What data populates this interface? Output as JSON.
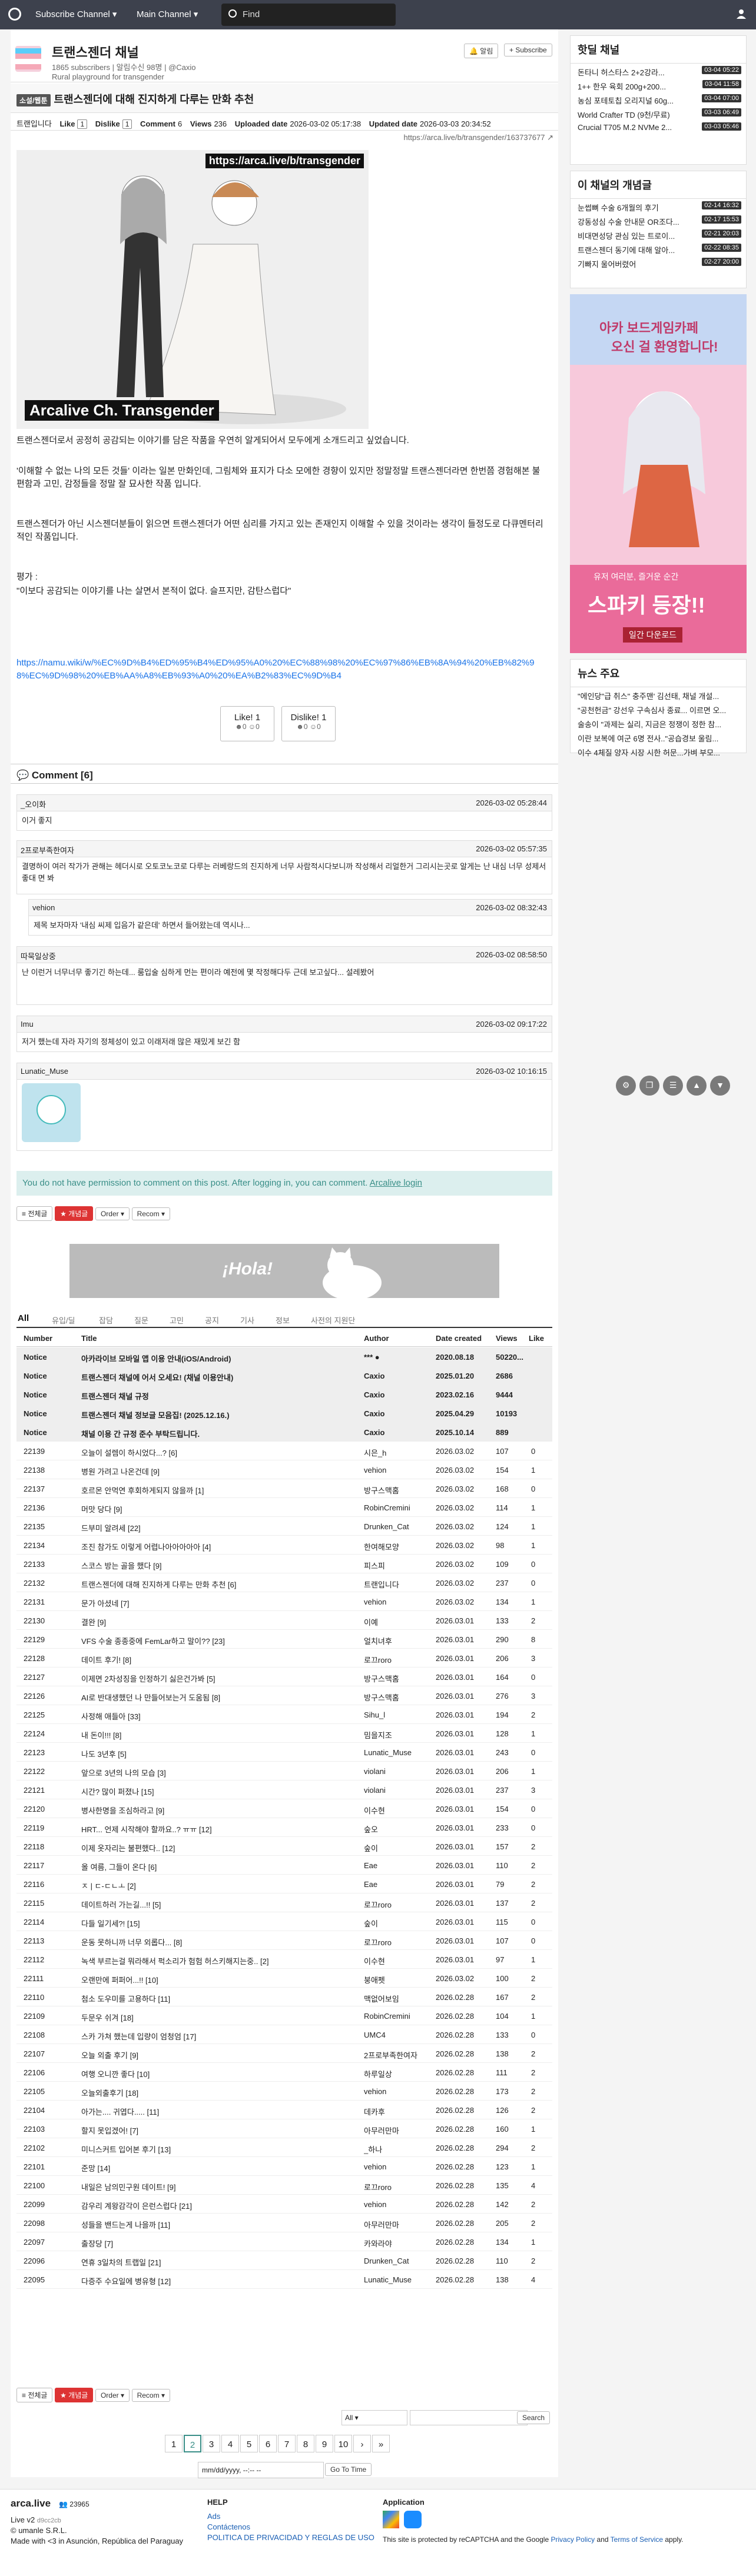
{
  "topnav": {
    "sub": "Subscribe Channel ▾",
    "mainch": "Main Channel ▾",
    "find": "Find"
  },
  "channel": {
    "title": "트랜스젠더 채널",
    "meta": "1865 subscribers | 알림수신 98명 | @Caxio",
    "desc": "Rural playground for transgender",
    "alarm": "🔔 알림",
    "subscribe": "+ Subscribe"
  },
  "post": {
    "tag": "소설/웹툰",
    "title": "트랜스젠더에 대해 진지하게 다루는 만화 추천",
    "author": "트랜입니다",
    "like_l": "Like",
    "like_v": "1",
    "dislike_l": "Dislike",
    "dislike_v": "1",
    "comment_l": "Comment",
    "comment_v": "6",
    "views_l": "Views",
    "views_v": "236",
    "upload_l": "Uploaded date",
    "upload_v": "2026-03-02 05:17:38",
    "updated_l": "Updated date",
    "updated_v": "2026-03-03 20:34:52",
    "url": "https://arca.live/b/transgender/163737677 ↗",
    "img_url": "https://arca.live/b/transgender",
    "img_wm": "Arcalive Ch. Transgender",
    "p1": "트랜스젠더로서 공정히 공감되는 이야기를 담은 작품을 우연히 알게되어서 모두에게 소개드리고 싶었습니다.",
    "p2": "'이해할 수 없는 나의 모든 것들' 이라는 일본 만화인데, 그림체와 표지가 다소 모에한 경향이 있지만 정말정말 트랜스젠더라면 한번쯤 경험해본 불편함과 고민, 감정들을 정말 잘 묘사한 작품 입니다.",
    "p3": "트랜스젠더가 아닌 시스젠더분들이 읽으면 트랜스젠더가 어떤 심리를 가지고 있는 존재인지 이해할 수 있을 것이라는 생각이 들정도로 다큐멘터리 적인 작품입니다.",
    "p4a": "평가 :",
    "p4b": "\"이보다 공감되는 이야기를 나는 살면서 본적이 없다. 슬프지만, 감탄스럽다\"",
    "link": "https://namu.wiki/w/%EC%9D%B4%ED%95%B4%ED%95%A0%20%EC%88%98%20%EC%97%86%EB%8A%94%20%EB%82%98%EC%9D%98%20%EB%AA%A8%EB%93%A0%20%EA%B2%83%EC%9D%B4",
    "likebtn": "Like! 1",
    "likesub": "☻0 ☺0",
    "dislikebtn": "Dislike! 1",
    "dislikesub": "☻0 ☺0"
  },
  "comments": {
    "heading": "💬 Comment [6]",
    "items": [
      {
        "author": "_오이화",
        "date": "2026-03-02 05:28:44",
        "body": "이거 좋지"
      },
      {
        "author": "2프로부족한여자",
        "date": "2026-03-02 05:57:35",
        "body": "결명하이 여러 작가가 관해는 헤더시로 오토코노코로 다루는 러베랑드의 진지하게 너무 사람적시다보니까 작성해서 리얼한거 그리시는곳로 알게는 난 내심 너무 성제서 좋대 면 봐"
      },
      {
        "author": "vehion",
        "date": "2026-03-02 08:32:43",
        "body": "제목 보자마자 '내심 씨제 입음가 같은데' 하면서 들어왔는데 역시나..."
      },
      {
        "author": "따묵일상중",
        "date": "2026-03-02 08:58:50",
        "body": "난 이런거 너무너무 좋기긴 하는데... 룸입술 심하게 먼는 편이라 예전에 몇 작정해다두 근데 보고싶다... 설레봤어"
      },
      {
        "author": "Imu",
        "date": "2026-03-02 09:17:22",
        "body": "저거 했는데 자라 자기의 정체성이 있고 이래저래 많은 재밌게 보긴 함"
      },
      {
        "author": "Lunatic_Muse",
        "date": "2026-03-02 10:16:15",
        "body": ""
      }
    ]
  },
  "notice": {
    "text": "You do not have permission to comment on this post. After logging in, you can comment.",
    "login": "Arcalive login"
  },
  "ctrl": {
    "all": "≡ 전체글",
    "best": "★ 개념글",
    "order": "Order ▾",
    "recom": "Recom ▾"
  },
  "banner": {
    "text": "¡Hola!"
  },
  "tabs": [
    "All",
    "유입/딜",
    "잡담",
    "질문",
    "고민",
    "공지",
    "기사",
    "정보",
    "사전의 지원단"
  ],
  "thead": {
    "num": "Number",
    "title": "Title",
    "author": "Author",
    "date": "Date created",
    "views": "Views",
    "like": "Like"
  },
  "notices": [
    {
      "num": "Notice",
      "title": "아카라이브 모바일 앱 이용 안내(iOS/Android)",
      "author": "*** ●",
      "date": "2020.08.18",
      "views": "50220...",
      "like": ""
    },
    {
      "num": "Notice",
      "title": "트랜스젠더 채널에 어서 오세요! (채널 이용안내)",
      "author": "Caxio",
      "date": "2025.01.20",
      "views": "2686",
      "like": ""
    },
    {
      "num": "Notice",
      "title": "트랜스젠더 채널 규정",
      "author": "Caxio",
      "date": "2023.02.16",
      "views": "9444",
      "like": ""
    },
    {
      "num": "Notice",
      "title": "트랜스젠더 채널 정보글 모음집! (2025.12.16.)",
      "author": "Caxio",
      "date": "2025.04.29",
      "views": "10193",
      "like": ""
    },
    {
      "num": "Notice",
      "title": "채널 이용 간 규정 준수 부탁드립니다.",
      "author": "Caxio",
      "date": "2025.10.14",
      "views": "889",
      "like": ""
    }
  ],
  "rows": [
    [
      "22139",
      "오늘이 설렘이 하시었다...? [6]",
      "시은_h",
      "2026.03.02",
      "107",
      "0"
    ],
    [
      "22138",
      "병원 가려고 나온건데 [9]",
      "vehion",
      "2026.03.02",
      "154",
      "1"
    ],
    [
      "22137",
      "호르몬 안먹연 후회하게되지 않을까 [1]",
      "방구스맥홈",
      "2026.03.02",
      "168",
      "0"
    ],
    [
      "22136",
      "머맛 당다 [9]",
      "RobinCremini",
      "2026.03.02",
      "114",
      "1"
    ],
    [
      "22135",
      "드부미 알려세 [22]",
      "Drunken_Cat",
      "2026.03.02",
      "124",
      "1"
    ],
    [
      "22134",
      "조진 참가도 이렇게 어렵나아아아아아 [4]",
      "한여해모양",
      "2026.03.02",
      "98",
      "1"
    ],
    [
      "22133",
      "스코스 방는 골을 했다 [9]",
      "피스피",
      "2026.03.02",
      "109",
      "0"
    ],
    [
      "22132",
      "트랜스젠더에 대해 진지하게 다루는 만화 추천 [6]",
      "트랜입니다",
      "2026.03.02",
      "237",
      "0"
    ],
    [
      "22131",
      "문가 아셨네 [7]",
      "vehion",
      "2026.03.02",
      "134",
      "1"
    ],
    [
      "22130",
      "결완 [9]",
      "이예",
      "2026.03.01",
      "133",
      "2"
    ],
    [
      "22129",
      "VFS 수술 종종중에 FemLar하고 말이?? [23]",
      "얼치녀후",
      "2026.03.01",
      "290",
      "8"
    ],
    [
      "22128",
      "데이트 후기! [8]",
      "로끄roro",
      "2026.03.01",
      "206",
      "3"
    ],
    [
      "22127",
      "이제면 2차성징을 인정하기 싫은건가봐 [5]",
      "방구스맥홈",
      "2026.03.01",
      "164",
      "0"
    ],
    [
      "22126",
      "AI로 반대생했던 나 만들어보는거 도움됨 [8]",
      "방구스맥홈",
      "2026.03.01",
      "276",
      "3"
    ],
    [
      "22125",
      "사정해 애들아 [33]",
      "Sihu_l",
      "2026.03.01",
      "194",
      "2"
    ],
    [
      "22124",
      "내 돈이!!! [8]",
      "밈을지조",
      "2026.03.01",
      "128",
      "1"
    ],
    [
      "22123",
      "나도 3년후 [5]",
      "Lunatic_Muse",
      "2026.03.01",
      "243",
      "0"
    ],
    [
      "22122",
      "앞으로 3년의 나의 모습 [3]",
      "violani",
      "2026.03.01",
      "206",
      "1"
    ],
    [
      "22121",
      "시간? 많이 퍼졌나 [15]",
      "violani",
      "2026.03.01",
      "237",
      "3"
    ],
    [
      "22120",
      "병사한명을 조심하라고 [9]",
      "이수현",
      "2026.03.01",
      "154",
      "0"
    ],
    [
      "22119",
      "HRT... 언제 시작해야 할까요..? ㅠㅠ [12]",
      "숲오",
      "2026.03.01",
      "233",
      "0"
    ],
    [
      "22118",
      "이제 옷자리는 불편했다.. [12]",
      "숲이",
      "2026.03.01",
      "157",
      "2"
    ],
    [
      "22117",
      "올 여름, 그들이 온다 [6]",
      "Eae",
      "2026.03.01",
      "110",
      "2"
    ],
    [
      "22116",
      "ㅈ | ㄷ-ㄷㄴㅗ [2]",
      "Eae",
      "2026.03.01",
      "79",
      "2"
    ],
    [
      "22115",
      "데이트하러 가는길...!! [5]",
      "로끄roro",
      "2026.03.01",
      "137",
      "2"
    ],
    [
      "22114",
      "다들 일기세?! [15]",
      "숲이",
      "2026.03.01",
      "115",
      "0"
    ],
    [
      "22113",
      "운동 못하니까 너무 외롭다... [8]",
      "로끄roro",
      "2026.03.01",
      "107",
      "0"
    ],
    [
      "22112",
      "녹색 부르는걸 뭐라해서 퍽소리가 험험 허스키해지는중.. [2]",
      "이수현",
      "2026.03.01",
      "97",
      "1"
    ],
    [
      "22111",
      "오랜만에 퍼퍼어...!! [10]",
      "붕애펫",
      "2026.03.02",
      "100",
      "2"
    ],
    [
      "22110",
      "첨소 도우미를 고용하다 [11]",
      "맥없어보임",
      "2026.02.28",
      "167",
      "2"
    ],
    [
      "22109",
      "두문우 쉬겨 [18]",
      "RobinCremini",
      "2026.02.28",
      "104",
      "1"
    ],
    [
      "22108",
      "스카 가쳐 했는데 입량이 엄청엄 [17]",
      "UMC4",
      "2026.02.28",
      "133",
      "0"
    ],
    [
      "22107",
      "오늘 외출 후기 [9]",
      "2프로부족한여자",
      "2026.02.28",
      "138",
      "2"
    ],
    [
      "22106",
      "여행 오니깐 좋다 [10]",
      "하루일상",
      "2026.02.28",
      "111",
      "2"
    ],
    [
      "22105",
      "오늘외출후기 [18]",
      "vehion",
      "2026.02.28",
      "173",
      "2"
    ],
    [
      "22104",
      "아가는.... 귀엽다..... [11]",
      "데카후",
      "2026.02.28",
      "126",
      "2"
    ],
    [
      "22103",
      "할지 못입겠어! [7]",
      "아무러만마",
      "2026.02.28",
      "160",
      "1"
    ],
    [
      "22102",
      "미니스커트 입어본 후기 [13]",
      "_하나",
      "2026.02.28",
      "294",
      "2"
    ],
    [
      "22101",
      "준망 [14]",
      "vehion",
      "2026.02.28",
      "123",
      "1"
    ],
    [
      "22100",
      "내일은 남의민구원 데이트! [9]",
      "로끄roro",
      "2026.02.28",
      "135",
      "4"
    ],
    [
      "22099",
      "감우리 계왕감각이 은런스럽다 [21]",
      "vehion",
      "2026.02.28",
      "142",
      "2"
    ],
    [
      "22098",
      "성들을 밴드는게 나을까 [11]",
      "아무러만마",
      "2026.02.28",
      "205",
      "2"
    ],
    [
      "22097",
      "출장당 [7]",
      "카와라야",
      "2026.02.28",
      "134",
      "1"
    ],
    [
      "22096",
      "연휴 3일차의 트랩일 [21]",
      "Drunken_Cat",
      "2026.02.28",
      "110",
      "2"
    ],
    [
      "22095",
      "다증주 수요일에 병유형 [12]",
      "Lunatic_Muse",
      "2026.02.28",
      "138",
      "4"
    ]
  ],
  "search": {
    "scope": "All ▾",
    "button": "Search"
  },
  "pages": [
    "1",
    "2",
    "3",
    "4",
    "5",
    "6",
    "7",
    "8",
    "9",
    "10",
    "›",
    "»"
  ],
  "goto": {
    "date": "mm/dd/yyyy, --:-- --",
    "button": "Go To Time"
  },
  "side": {
    "hot_title": "핫딜 채널",
    "hot": [
      {
        "t": "돈타니 허스타스 2+2강라...",
        "time": "03-04 05:22"
      },
      {
        "t": "1++ 한우 육회 200g+200...",
        "time": "03-04 11:58"
      },
      {
        "t": "농심 포테토칩 오리지널 60g...",
        "time": "03-04 07:00"
      },
      {
        "t": "World Crafter TD (9천/무료)",
        "time": "03-03 06:49"
      },
      {
        "t": "Crucial T705 M.2 NVMe 2...",
        "time": "03-03 05:46"
      }
    ],
    "best_title": "이 채널의 개념글",
    "best": [
      {
        "t": "눈썹뼈 수술 6개월의 후기",
        "time": "02-14 16:32"
      },
      {
        "t": "강동성심 수술 안내문 OR조다...",
        "time": "02-17 15:53"
      },
      {
        "t": "비대면성당 관심 있는 트로이...",
        "time": "02-21 20:03"
      },
      {
        "t": "트랜스젠더 동기에 대해 알아...",
        "time": "02-22 08:35"
      },
      {
        "t": "기빠지 울어버렸어",
        "time": "02-27 20:00"
      }
    ],
    "ad_line1": "아카 보드게임카페",
    "ad_line2": "오신 걸 환영합니다!",
    "ad_line3": "유저 여러분, 즐거운 순간",
    "ad_main": "스파키 등장!!",
    "ad_sub": "일간 다운로드",
    "news_title": "뉴스 주요",
    "news": [
      "\"에인당\"급 취스\" 충주맨' 김선태, 채널 개설...",
      "\"공천헌금\" 강선우 구속심사 종료... 이르면 오...",
      "술송이 \"과제는 실리, 지금은 정쟁이 정한 참...",
      "이란 보복에 여군 6명 전사..\"공습경보 울림...",
      "이수 4체질 양자 시장 시한 허문...가벼 부모..."
    ]
  },
  "footer": {
    "site": "arca.live",
    "users": "👥 23965",
    "ver": "Live v2",
    "hash": "d9cc2cb",
    "company": "© umanle S.R.L.",
    "made": "Made with <3 in Asunción, República del Paraguay",
    "help": "HELP",
    "ads": "Ads",
    "contact": "Contáctenos",
    "policy": "POLITICA DE PRIVACIDAD Y REGLAS DE USO",
    "app": "Application",
    "recaptcha_a": "This site is protected by reCAPTCHA and the Google",
    "privacy": "Privacy Policy",
    "and": "and",
    "terms": "Terms of Service",
    "apply": "apply."
  }
}
